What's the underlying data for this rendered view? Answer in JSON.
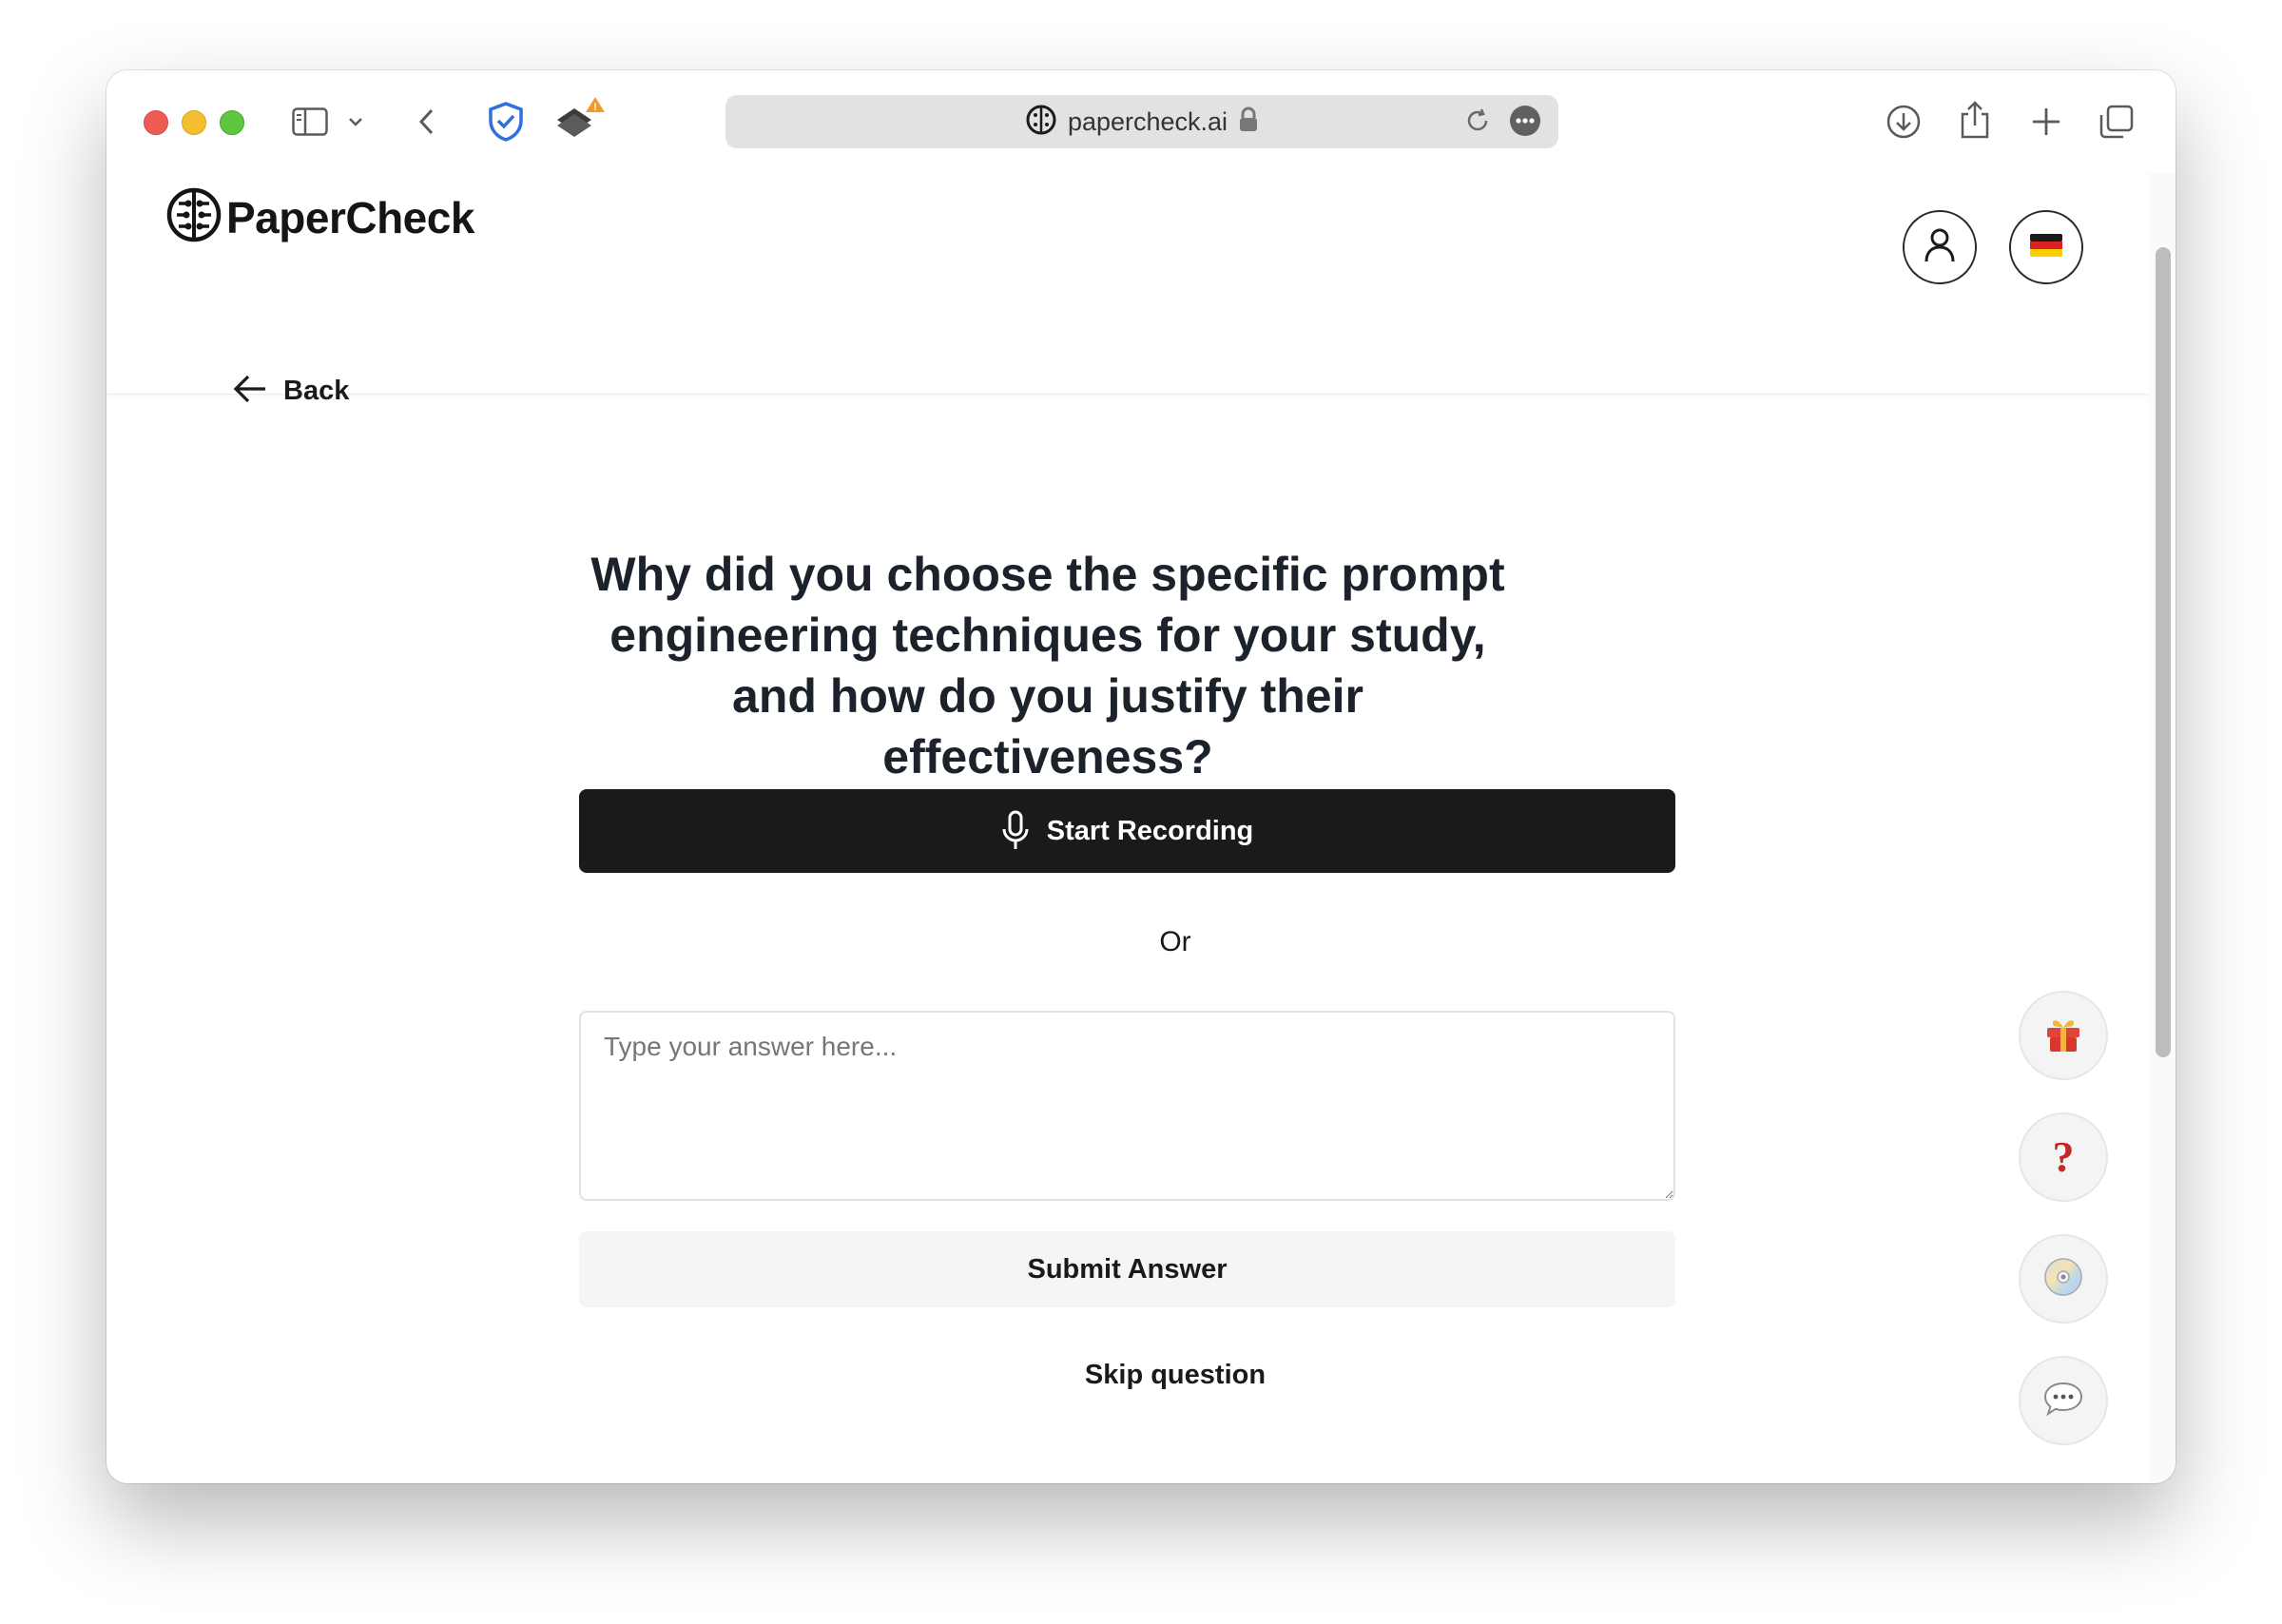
{
  "browser": {
    "url": "papercheck.ai"
  },
  "header": {
    "logo_text": "PaperCheck",
    "account_icon": "user-icon",
    "language_flag": "german-flag"
  },
  "nav": {
    "back_label": "Back"
  },
  "question": {
    "text": "Why did you choose the specific prompt engineering techniques for your study, and how do you justify their effectiveness?"
  },
  "actions": {
    "record_label": "Start Recording",
    "or_label": "Or",
    "answer_placeholder": "Type your answer here...",
    "submit_label": "Submit Answer",
    "skip_label": "Skip question"
  },
  "floating": {
    "icons": [
      "gift-icon",
      "question-icon",
      "disc-icon",
      "chat-icon"
    ]
  },
  "colors": {
    "primary_button": "#1a1a1a",
    "question_text": "#1c222c",
    "help_red": "#c62828"
  }
}
